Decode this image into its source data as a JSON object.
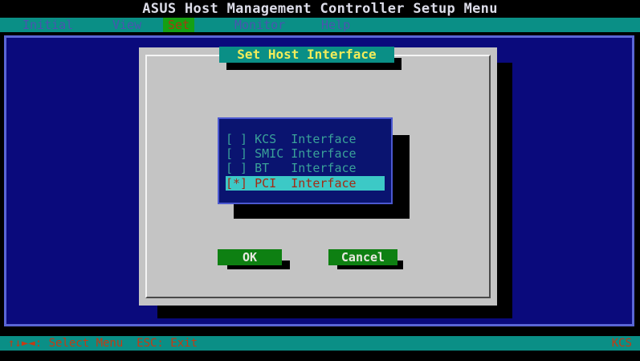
{
  "window": {
    "title": "ASUS Host Management Controller Setup Menu"
  },
  "menu": {
    "items": [
      {
        "label": "Initial"
      },
      {
        "label": "View"
      },
      {
        "label": "Set"
      },
      {
        "label": "Monitor"
      },
      {
        "label": "Help"
      }
    ],
    "active": "Set"
  },
  "dialog": {
    "title": "Set Host Interface",
    "options": [
      {
        "label": "[ ] KCS  Interface",
        "selected": false
      },
      {
        "label": "[ ] SMIC Interface",
        "selected": false
      },
      {
        "label": "[ ] BT   Interface",
        "selected": false
      },
      {
        "label": "[*] PCI  Interface",
        "selected": true
      }
    ],
    "ok_label": "OK",
    "cancel_label": "Cancel"
  },
  "status": {
    "help": "↑↓►◄: Select Menu  ESC: Exit",
    "mode": "KCS"
  },
  "colors": {
    "background": "#0a0a7c",
    "accent": "#0a8f86",
    "button": "#0e8012",
    "selection": "#3cc9c6",
    "highlight_text": "#c53a14"
  }
}
